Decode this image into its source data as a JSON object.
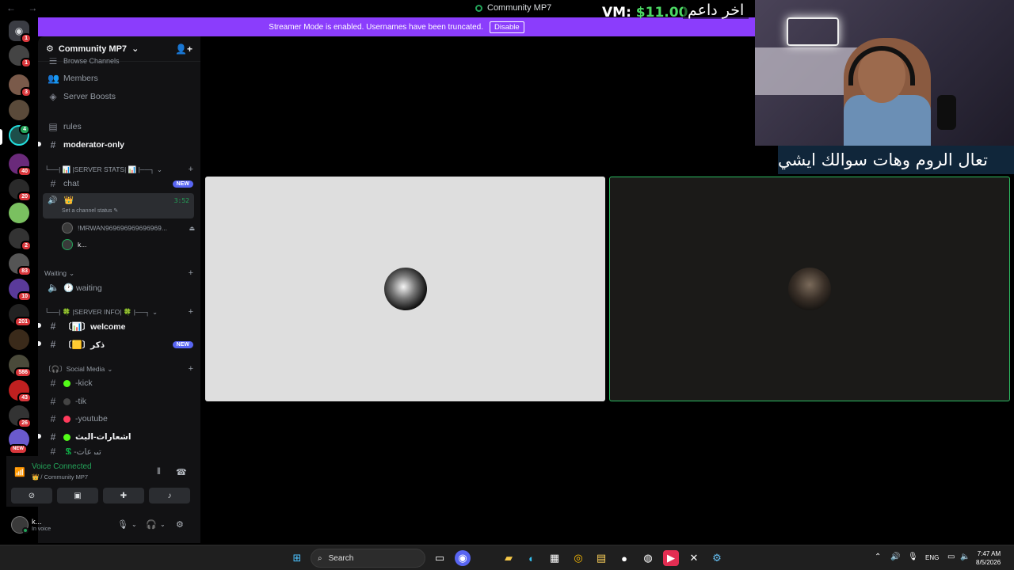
{
  "window": {
    "title": "Community MP7",
    "nav": "← →"
  },
  "banner": {
    "text": "Streamer Mode is enabled. Usernames have been truncated.",
    "button": "Disable"
  },
  "rail": {
    "badges": [
      "1",
      "1",
      "3",
      "4",
      "40",
      "20",
      "2",
      "83",
      "10",
      "201",
      "586",
      "43",
      "26"
    ],
    "new_label": "NEW"
  },
  "server": {
    "name": "Community MP7"
  },
  "channels": {
    "browse": "Browse Channels",
    "members": "Members",
    "boosts": "Server Boosts",
    "rules": "rules",
    "moderator": "moderator-only",
    "cat_stats": "└──| 📊 |SERVER STATS| 📊 |──┐",
    "chat": "chat",
    "new": "NEW",
    "voice_name": "👑",
    "voice_time": "3:52",
    "voice_status": "Set a channel status ✎",
    "vuser1": "!MRWAN969696969696969...",
    "vuser2": "k...",
    "cat_waiting": "Waiting",
    "waiting": "🕐 waiting",
    "cat_info": "└──| 🍀 |SERVER INFO| 🍀 |──┐",
    "welcome": "〔📊〕welcome",
    "thikr": "〔🟨〕ذكر",
    "cat_social": "〔🎧〕Social Media",
    "kick": "-kick",
    "tik": "-tik",
    "youtube": "-youtube",
    "ishar": "اشعارات-البث",
    "last": "💲-تبرعات"
  },
  "voice_panel": {
    "status": "Voice Connected",
    "sub": "👑 / Community MP7"
  },
  "user": {
    "name": "k...",
    "status": "In voice"
  },
  "overlay": {
    "vm_label": "VM:",
    "vm_amount": "$11.00",
    "arabic_top": "اخر داعم",
    "arabic_bottom": "تعال الروم وهات سوالك ايشي"
  },
  "taskbar": {
    "search": "Search",
    "lang": "ENG",
    "time": "7:47 AM",
    "date": "8/5/2026"
  },
  "colors": {
    "accent": "#8b3dfc",
    "online": "#23a55a",
    "badge": "#da373c",
    "new": "#5865f2"
  }
}
